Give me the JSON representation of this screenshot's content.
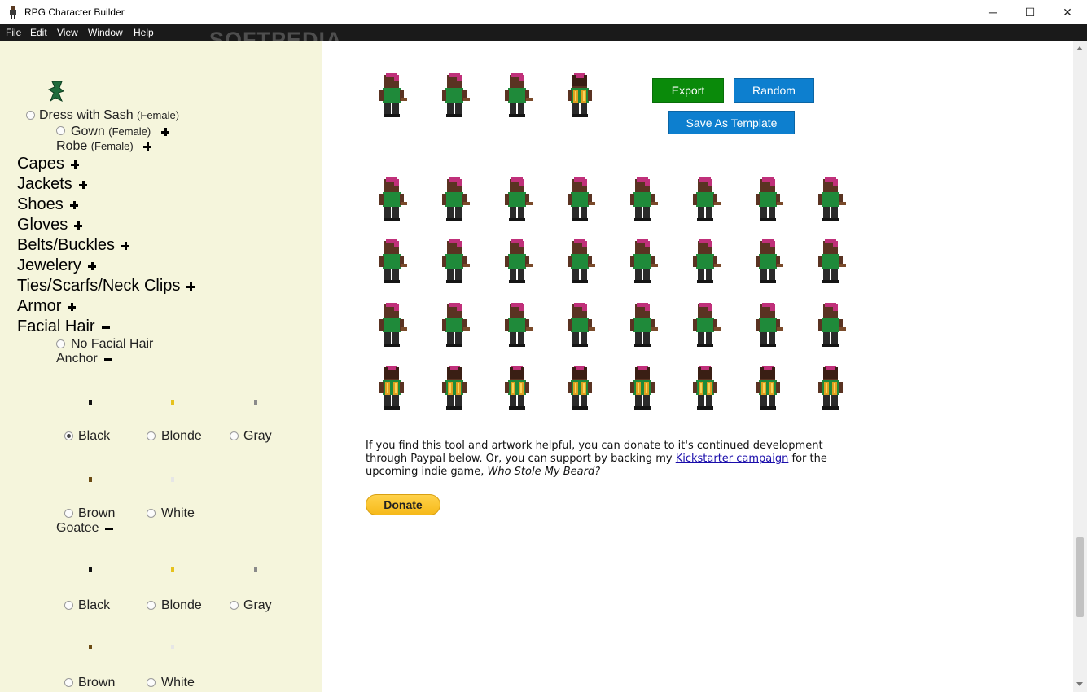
{
  "window": {
    "title": "RPG Character Builder",
    "minimize": "─",
    "maximize": "☐",
    "close": "✕"
  },
  "menu": [
    "File",
    "Edit",
    "View",
    "Window",
    "Help"
  ],
  "watermark": "SOFTPEDIA",
  "sidebar": {
    "dress_sash": {
      "label": "Dress with Sash",
      "qualifier": "(Female)"
    },
    "gown": {
      "label": "Gown",
      "qualifier": "(Female)"
    },
    "robe": {
      "label": "Robe",
      "qualifier": "(Female)"
    },
    "categories": [
      "Capes",
      "Jackets",
      "Shoes",
      "Gloves",
      "Belts/Buckles",
      "Jewelery",
      "Ties/Scarfs/Neck Clips",
      "Armor"
    ],
    "facial_hair": {
      "label": "Facial Hair",
      "none_option": "No Facial Hair",
      "anchor": {
        "label": "Anchor",
        "colors": [
          "Black",
          "Blonde",
          "Gray",
          "Brown",
          "White"
        ],
        "selected": "Black"
      },
      "goatee": {
        "label": "Goatee",
        "colors": [
          "Black",
          "Blonde",
          "Gray",
          "Brown",
          "White"
        ]
      }
    },
    "swatch_colors": {
      "Black": "#111111",
      "Blonde": "#e6c21c",
      "Gray": "#8a8a8a",
      "Brown": "#6b4a12",
      "White": "#e6e6e6"
    }
  },
  "buttons": {
    "export": {
      "label": "Export",
      "color": "#0a8a0a"
    },
    "random": {
      "label": "Random",
      "color": "#0d7fcf"
    },
    "save_template": {
      "label": "Save As Template",
      "color": "#0d7fcf"
    }
  },
  "preview": {
    "directions": [
      "front",
      "left",
      "right",
      "back"
    ],
    "rows": [
      "front",
      "left",
      "right",
      "back"
    ],
    "frames_per_row": 8
  },
  "donate": {
    "text_1": "If you find this tool and artwork helpful, you can donate to it's continued development through Paypal below. Or, you can support by backing my ",
    "link": "Kickstarter campaign",
    "text_2": " for the upcoming indie game, ",
    "game": "Who Stole My Beard?",
    "button": "Donate"
  },
  "colors": {
    "sidebar_bg": "#f5f5dc",
    "menubar_bg": "#1a1a1a",
    "hair": "#c0307a",
    "shirt": "#1f8a3a",
    "skin": "#5a3322"
  }
}
